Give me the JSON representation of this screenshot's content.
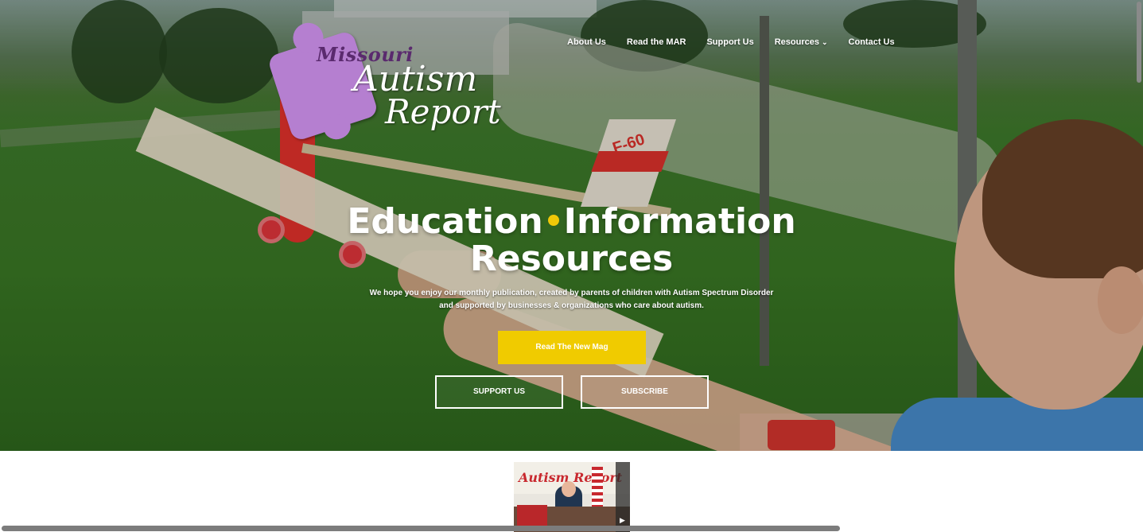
{
  "nav": {
    "items": [
      {
        "label": "About Us"
      },
      {
        "label": "Read the MAR"
      },
      {
        "label": "Support Us"
      },
      {
        "label": "Resources",
        "has_dropdown": true
      },
      {
        "label": "Contact Us"
      }
    ],
    "dropdown_icon": "chevron-down-icon"
  },
  "logo": {
    "line1": "Missouri",
    "line2": "Autism",
    "line3": "Report",
    "puzzle_color": "#b57fd0"
  },
  "hero": {
    "headline_part1": "Education",
    "headline_part2": "Information",
    "headline_line2": "Resources",
    "separator_color": "#f0c808",
    "tagline_line1": "We hope you enjoy our monthly publication, created by parents of children with Autism Spectrum Disorder",
    "tagline_line2": "and supported by businesses & organizations who care about autism.",
    "plane_tail_text": "F-60"
  },
  "buttons": {
    "primary": "Read The New Mag",
    "primary_color": "#f0cb00",
    "support": "SUPPORT US",
    "subscribe": "SUBSCRIBE"
  },
  "thumbnail": {
    "title": "Autism Report",
    "play_icon": "play-icon"
  }
}
